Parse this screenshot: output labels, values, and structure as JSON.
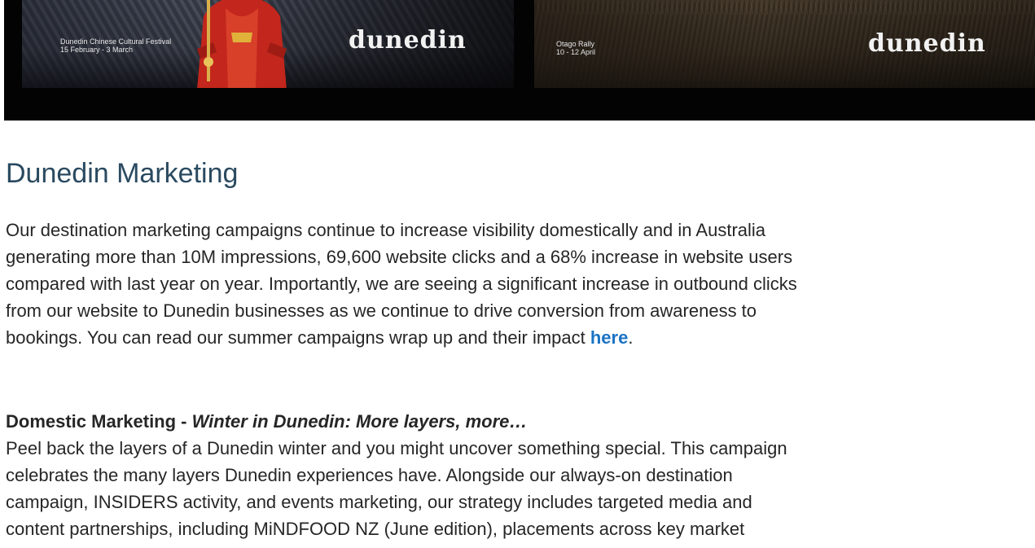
{
  "banner": {
    "left_panel": {
      "event_name": "Dunedin Chinese Cultural Festival",
      "event_dates": "15 February - 3 March",
      "logo_text": "dunedin"
    },
    "right_panel": {
      "event_name": "Otago Rally",
      "event_dates": "10 - 12 April",
      "logo_text": "dunedin"
    }
  },
  "article": {
    "heading": "Dunedin Marketing",
    "paragraph1": {
      "line1": "Our destination marketing campaigns continue to increase visibility domestically and in Australia",
      "line2": "generating more than 10M impressions, 69,600 website clicks and a 68% increase in website users",
      "line3": "compared with last year on year. Importantly, we are seeing a significant increase in outbound clicks",
      "line4": "from our website to Dunedin businesses as we continue to drive conversion from awareness to",
      "line5_before_link": "bookings. You can read our summer campaigns wrap up and their impact ",
      "link_text": "here",
      "line5_after_link": "."
    },
    "section": {
      "title_bold": "Domestic Marketing - ",
      "title_italic": "Winter in Dunedin: More layers, more…"
    },
    "paragraph2": {
      "line1": "Peel back the layers of a Dunedin winter and you might uncover something special. This campaign",
      "line2": "celebrates the many layers Dunedin experiences have. Alongside our always-on destination",
      "line3": "campaign, INSIDERS activity, and events marketing, our strategy includes targeted media and",
      "line4": "content partnerships, including MiNDFOOD NZ (June edition), placements across key market"
    }
  }
}
